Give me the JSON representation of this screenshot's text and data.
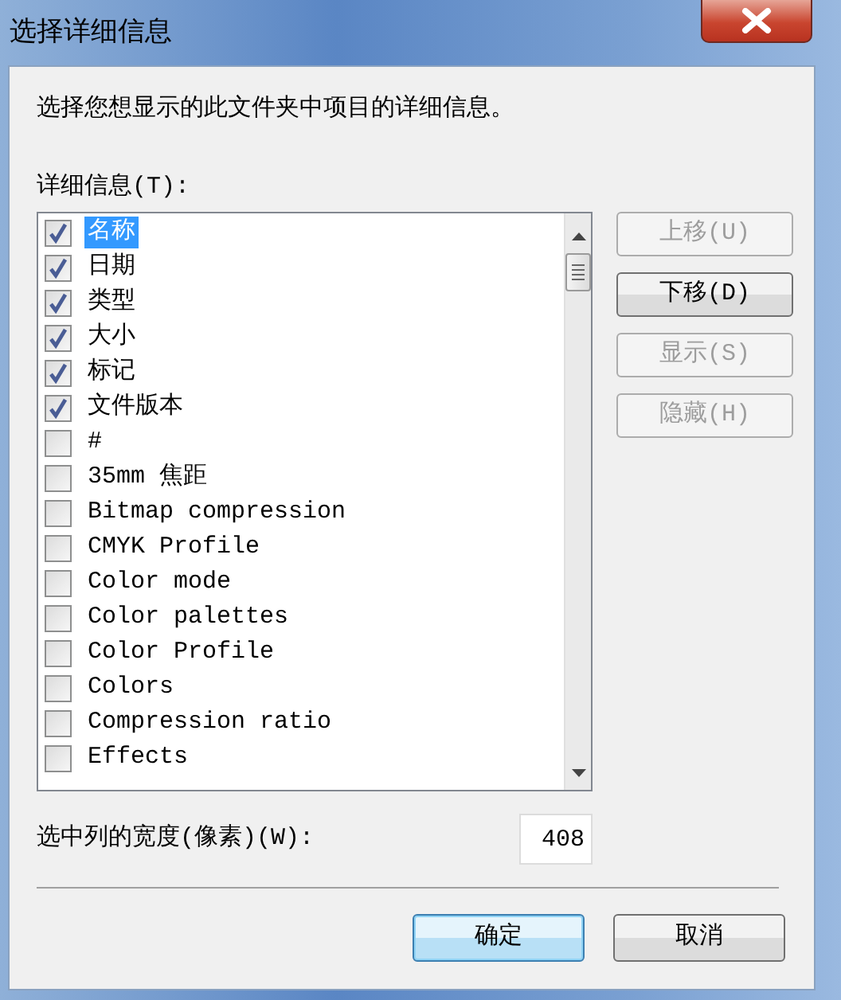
{
  "window": {
    "title": "选择详细信息"
  },
  "instruction": "选择您想显示的此文件夹中项目的详细信息。",
  "details_label": "详细信息(T):",
  "items": [
    {
      "label": "名称",
      "checked": true,
      "selected": true
    },
    {
      "label": "日期",
      "checked": true,
      "selected": false
    },
    {
      "label": "类型",
      "checked": true,
      "selected": false
    },
    {
      "label": "大小",
      "checked": true,
      "selected": false
    },
    {
      "label": "标记",
      "checked": true,
      "selected": false
    },
    {
      "label": "文件版本",
      "checked": true,
      "selected": false
    },
    {
      "label": "#",
      "checked": false,
      "selected": false
    },
    {
      "label": "35mm 焦距",
      "checked": false,
      "selected": false
    },
    {
      "label": "Bitmap compression",
      "checked": false,
      "selected": false
    },
    {
      "label": "CMYK Profile",
      "checked": false,
      "selected": false
    },
    {
      "label": "Color mode",
      "checked": false,
      "selected": false
    },
    {
      "label": "Color palettes",
      "checked": false,
      "selected": false
    },
    {
      "label": "Color Profile",
      "checked": false,
      "selected": false
    },
    {
      "label": "Colors",
      "checked": false,
      "selected": false
    },
    {
      "label": "Compression ratio",
      "checked": false,
      "selected": false
    },
    {
      "label": "Effects",
      "checked": false,
      "selected": false
    }
  ],
  "side_buttons": [
    {
      "label": "上移(U)",
      "disabled": true
    },
    {
      "label": "下移(D)",
      "disabled": false
    },
    {
      "label": "显示(S)",
      "disabled": true
    },
    {
      "label": "隐藏(H)",
      "disabled": true
    }
  ],
  "width_label": "选中列的宽度(像素)(W):",
  "width_value": "408",
  "buttons": [
    {
      "label": "确定",
      "kind": "default"
    },
    {
      "label": "取消",
      "kind": "normal"
    }
  ]
}
